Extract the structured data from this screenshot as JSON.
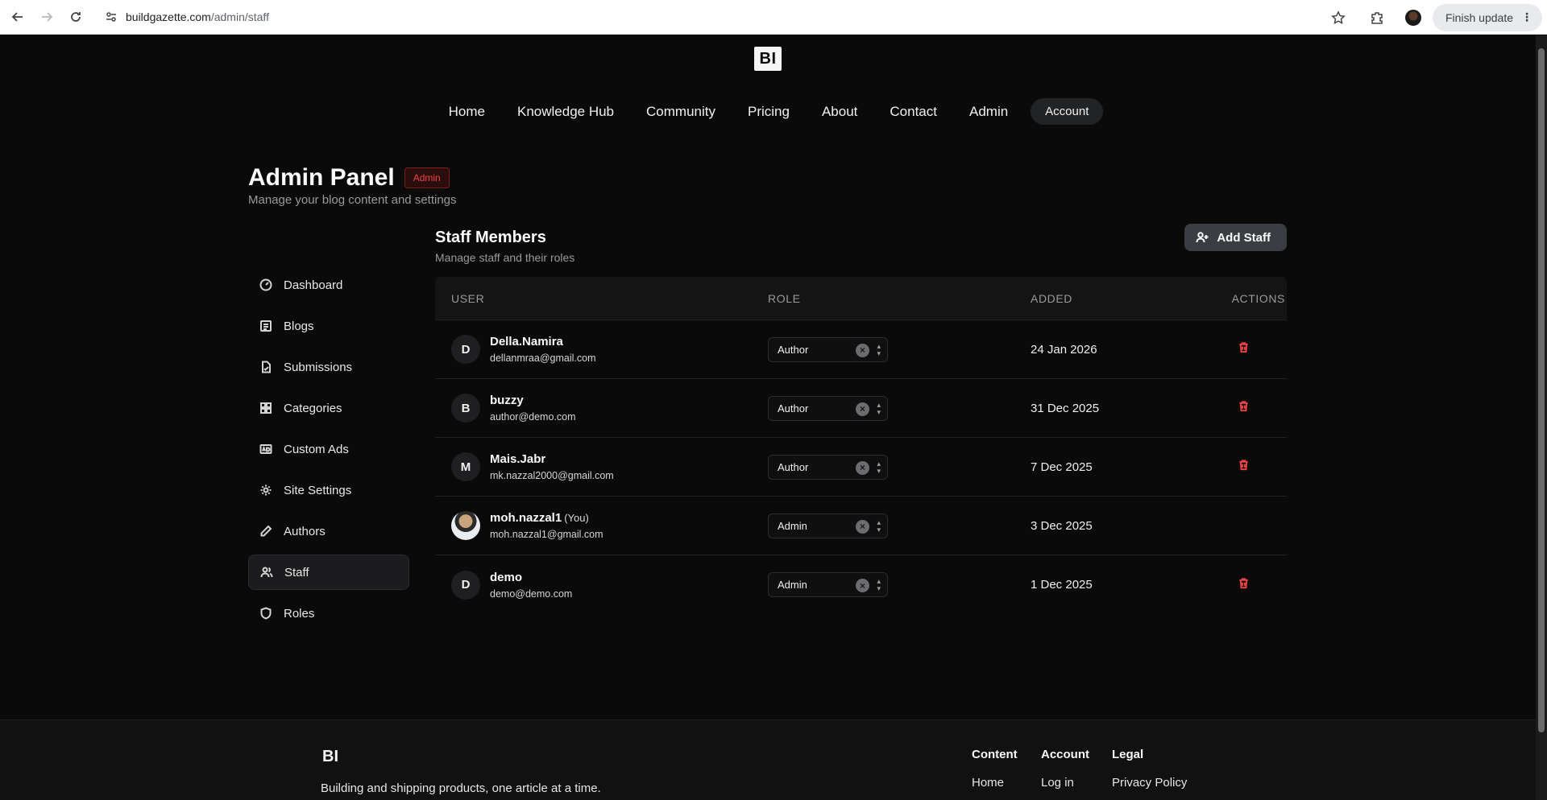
{
  "browser": {
    "url_host": "buildgazette.com",
    "url_path": "/admin/staff",
    "finish_update": "Finish update"
  },
  "site": {
    "logo": "BI",
    "nav": [
      "Home",
      "Knowledge Hub",
      "Community",
      "Pricing",
      "About",
      "Contact",
      "Admin"
    ],
    "account": "Account"
  },
  "admin": {
    "title": "Admin Panel",
    "badge": "Admin",
    "subtitle": "Manage your blog content and settings"
  },
  "sidebar": {
    "items": [
      {
        "label": "Dashboard",
        "icon": "gauge-icon"
      },
      {
        "label": "Blogs",
        "icon": "list-icon"
      },
      {
        "label": "Submissions",
        "icon": "file-check-icon"
      },
      {
        "label": "Categories",
        "icon": "grid-icon"
      },
      {
        "label": "Custom Ads",
        "icon": "ad-icon"
      },
      {
        "label": "Site Settings",
        "icon": "gear-icon"
      },
      {
        "label": "Authors",
        "icon": "pen-icon"
      },
      {
        "label": "Staff",
        "icon": "users-icon"
      },
      {
        "label": "Roles",
        "icon": "shield-icon"
      }
    ],
    "active": "Staff"
  },
  "staff": {
    "title": "Staff Members",
    "subtitle": "Manage staff and their roles",
    "add_button": "Add Staff",
    "columns": [
      "USER",
      "ROLE",
      "ADDED",
      "ACTIONS"
    ],
    "rows": [
      {
        "initial": "D",
        "name": "Della.Namira",
        "you": "",
        "email": "dellanmraa@gmail.com",
        "role": "Author",
        "added": "24 Jan 2026",
        "deletable": true
      },
      {
        "initial": "B",
        "name": "buzzy",
        "you": "",
        "email": "author@demo.com",
        "role": "Author",
        "added": "31 Dec 2025",
        "deletable": true
      },
      {
        "initial": "M",
        "name": "Mais.Jabr",
        "you": "",
        "email": "mk.nazzal2000@gmail.com",
        "role": "Author",
        "added": "7 Dec 2025",
        "deletable": true
      },
      {
        "initial": "",
        "name": "moh.nazzal1",
        "you": "(You)",
        "email": "moh.nazzal1@gmail.com",
        "role": "Admin",
        "added": "3 Dec 2025",
        "deletable": false
      },
      {
        "initial": "D",
        "name": "demo",
        "you": "",
        "email": "demo@demo.com",
        "role": "Admin",
        "added": "1 Dec 2025",
        "deletable": true
      }
    ]
  },
  "footer": {
    "logo": "BI",
    "tagline": "Building and shipping products, one article at a time.",
    "columns": [
      {
        "heading": "Content",
        "link": "Home"
      },
      {
        "heading": "Account",
        "link": "Log in"
      },
      {
        "heading": "Legal",
        "link": "Privacy Policy"
      }
    ]
  }
}
